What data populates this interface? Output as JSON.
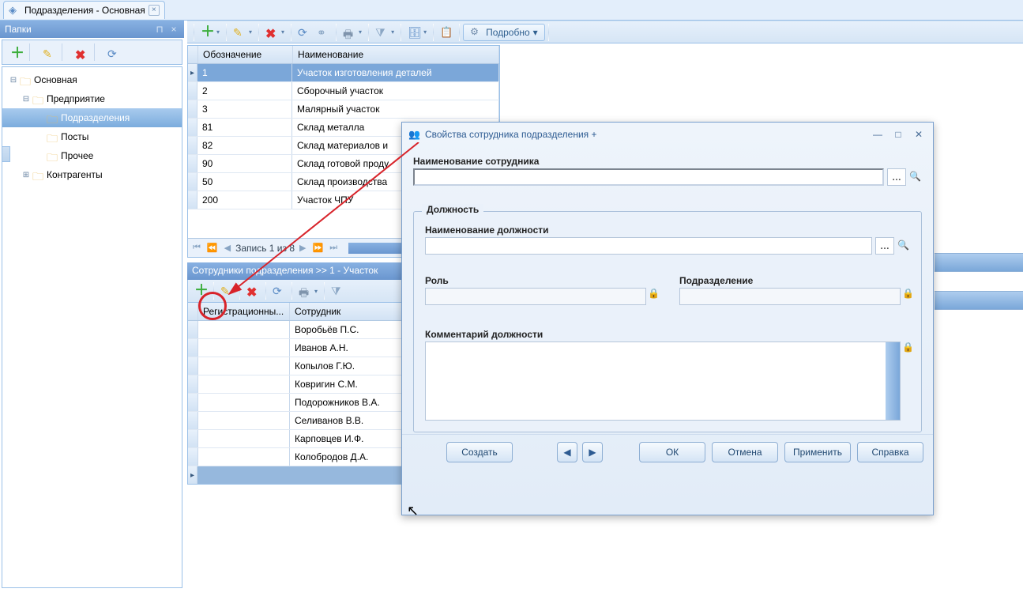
{
  "tab": {
    "title": "Подразделения - Основная"
  },
  "folders_panel": {
    "title": "Папки",
    "tree": {
      "root": "Основная",
      "enterprise": "Предприятие",
      "departments": "Подразделения",
      "posts": "Посты",
      "other": "Прочее",
      "contragents": "Контрагенты"
    }
  },
  "main_toolbar": {
    "detail": "Подробно"
  },
  "main_grid": {
    "cols": {
      "code": "Обозначение",
      "name": "Наименование"
    },
    "rows": [
      {
        "code": "1",
        "name": "Участок изготовления деталей"
      },
      {
        "code": "2",
        "name": "Сборочный участок"
      },
      {
        "code": "3",
        "name": "Малярный участок"
      },
      {
        "code": "81",
        "name": "Склад металла"
      },
      {
        "code": "82",
        "name": "Склад материалов и"
      },
      {
        "code": "90",
        "name": "Склад готовой проду"
      },
      {
        "code": "50",
        "name": "Склад производства"
      },
      {
        "code": "200",
        "name": "Участок ЧПУ"
      }
    ],
    "pager": "Запись 1 из 8"
  },
  "sub_panel": {
    "title": "Сотрудники подразделения >> 1 - Участок",
    "cols": {
      "reg": "Регистрационны...",
      "emp": "Сотрудник"
    },
    "rows": [
      {
        "emp": "Воробьёв П.С."
      },
      {
        "emp": "Иванов А.Н."
      },
      {
        "emp": "Копылов Г.Ю."
      },
      {
        "emp": "Ковригин С.М."
      },
      {
        "emp": "Подорожников В.А."
      },
      {
        "emp": "Селиванов В.В."
      },
      {
        "emp": "Карповцев И.Ф."
      },
      {
        "emp": "Колобродов Д.А."
      }
    ]
  },
  "dialog": {
    "title": "Свойства сотрудника подразделения +",
    "employee_name_label": "Наименование сотрудника",
    "position_group": "Должность",
    "position_name_label": "Наименование должности",
    "role_label": "Роль",
    "department_label": "Подразделение",
    "position_comment_label": "Комментарий должности",
    "buttons": {
      "create": "Создать",
      "ok": "ОК",
      "cancel": "Отмена",
      "apply": "Применить",
      "help": "Справка"
    }
  }
}
